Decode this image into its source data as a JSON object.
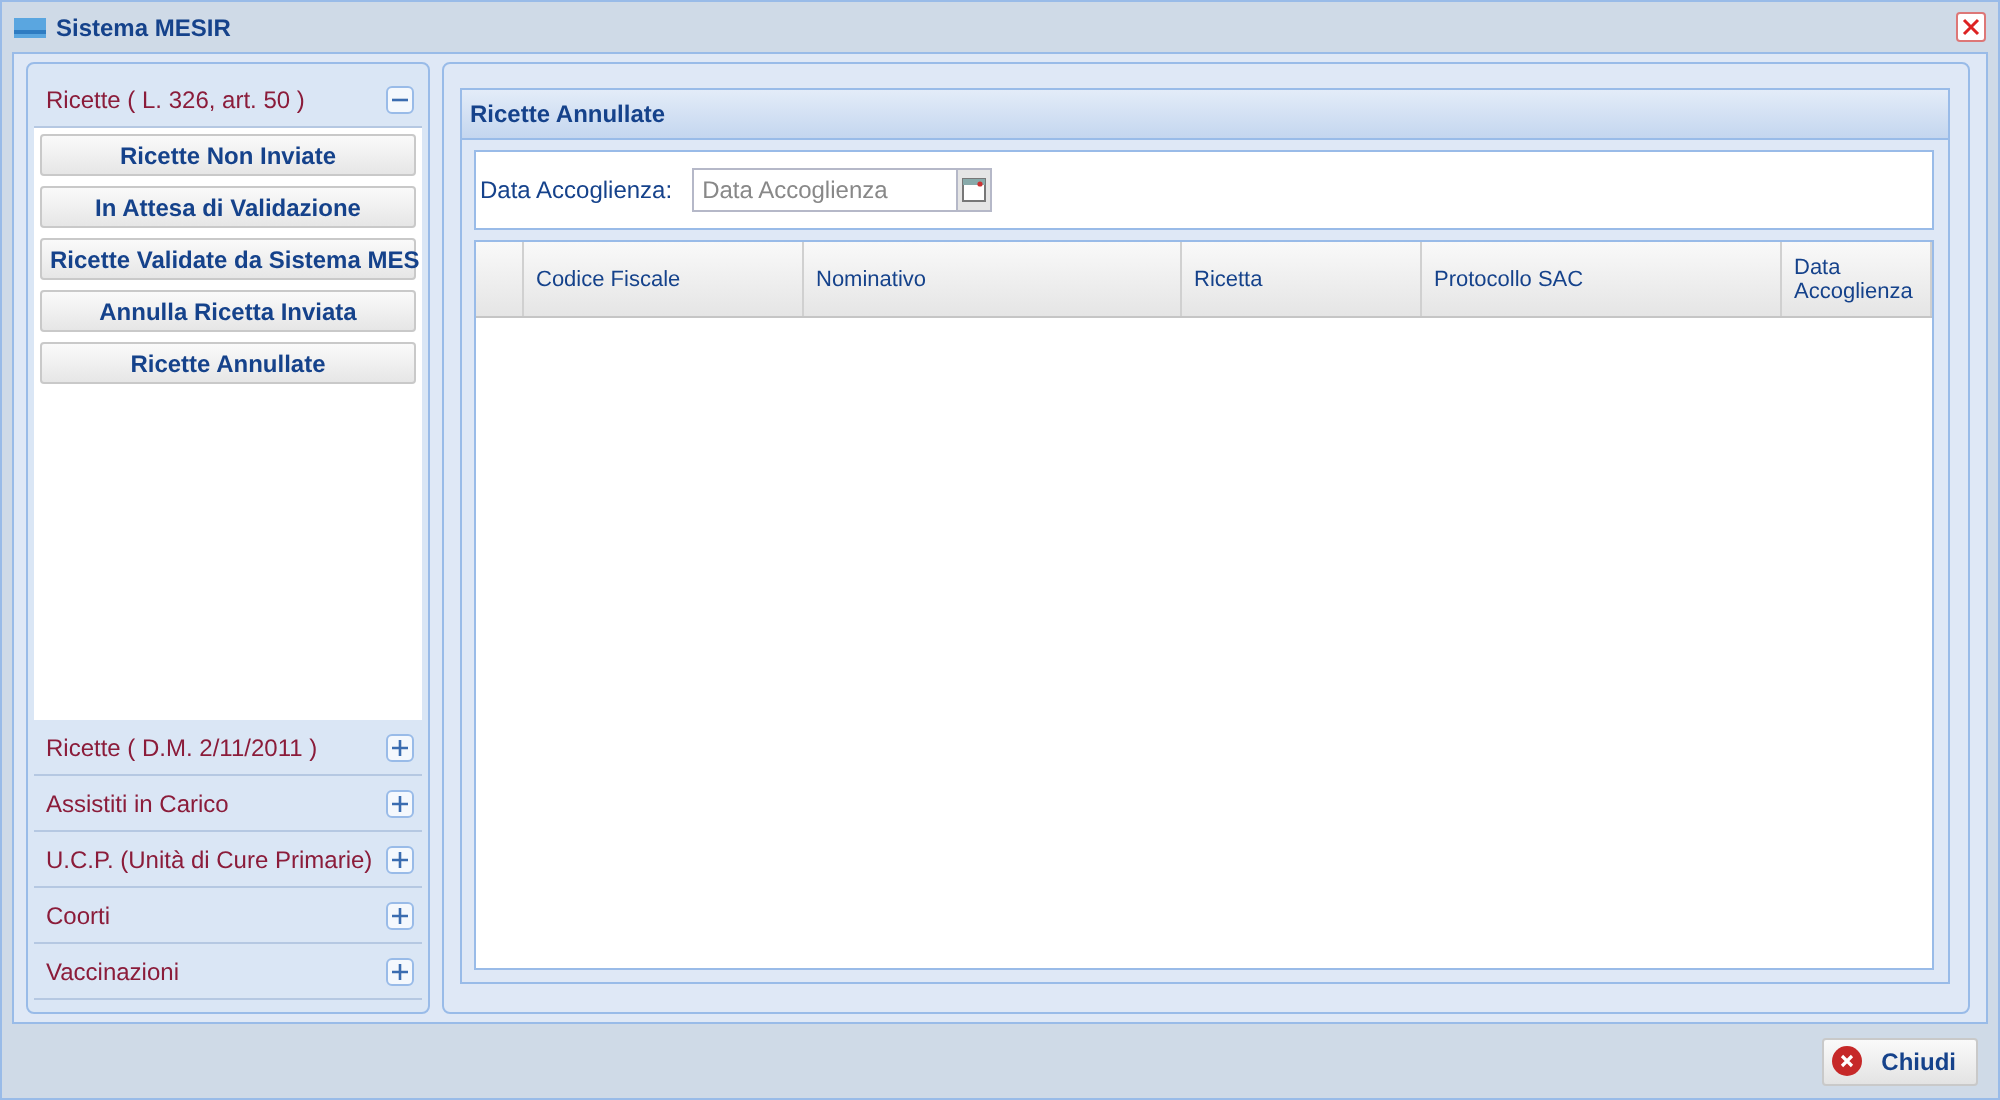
{
  "window": {
    "title": "Sistema MESIR"
  },
  "sidebar": {
    "sections": [
      {
        "label": "Ricette ( L. 326, art. 50 )",
        "expanded": true,
        "items": [
          "Ricette Non Inviate",
          "In Attesa di Validazione",
          "Ricette Validate da Sistema MES",
          "Annulla Ricetta Inviata",
          "Ricette Annullate"
        ]
      },
      {
        "label": "Ricette ( D.M. 2/11/2011 )",
        "expanded": false
      },
      {
        "label": "Assistiti in Carico",
        "expanded": false
      },
      {
        "label": "U.C.P. (Unità di Cure Primarie)",
        "expanded": false
      },
      {
        "label": "Coorti",
        "expanded": false
      },
      {
        "label": "Vaccinazioni",
        "expanded": false
      }
    ]
  },
  "panel": {
    "title": "Ricette Annullate",
    "filter": {
      "label": "Data Accoglienza:",
      "placeholder": "Data Accoglienza"
    },
    "table": {
      "columns": [
        "Codice Fiscale",
        "Nominativo",
        "Ricetta",
        "Protocollo SAC",
        "Data Accoglienza"
      ]
    }
  },
  "footer": {
    "button": "Chiudi"
  }
}
